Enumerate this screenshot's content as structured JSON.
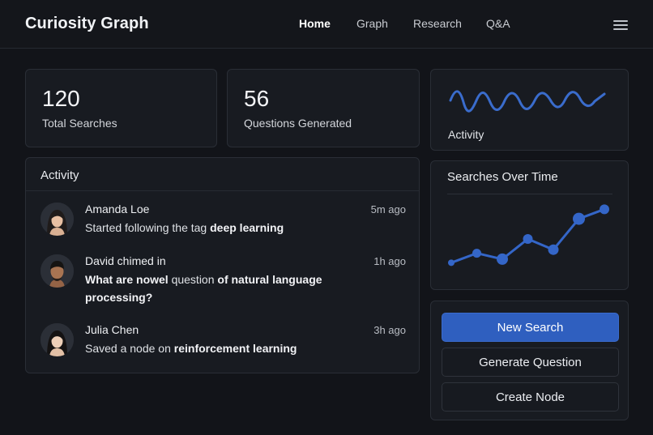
{
  "app": {
    "title": "Curiosity Graph"
  },
  "nav": {
    "items": [
      "Home",
      "Graph",
      "Research",
      "Q&A"
    ],
    "active": "Home"
  },
  "stats": [
    {
      "value": "120",
      "label": "Total Searches"
    },
    {
      "value": "56",
      "label": "Questions Generated"
    }
  ],
  "activity_mini": {
    "label": "Activity"
  },
  "activity": {
    "title": "Activity",
    "items": [
      {
        "name": "Amanda Loe",
        "time": "5m ago",
        "text_prefix": "Started following the tag ",
        "text_bold": "deep learning",
        "text_middle": "",
        "text_bold2": ""
      },
      {
        "name": "David chimed in",
        "time": "1h ago",
        "text_prefix": "",
        "text_bold": "What are nowel",
        "text_middle": " question ",
        "text_bold2": "of natural language processing?"
      },
      {
        "name": "Julia Chen",
        "time": "3h ago",
        "text_prefix": "Saved a node on ",
        "text_bold": "reinforcement learning",
        "text_middle": "",
        "text_bold2": ""
      }
    ]
  },
  "chart": {
    "title": "Searches Over Time"
  },
  "chart_data": {
    "type": "line",
    "title": "Searches Over Time",
    "x": [
      1,
      2,
      3,
      4,
      5,
      6,
      7
    ],
    "values": [
      10,
      18,
      13,
      30,
      21,
      47,
      55
    ],
    "ylim": [
      0,
      60
    ],
    "xlabel": "",
    "ylabel": "",
    "grid": false,
    "color": "#3466c8"
  },
  "actions": {
    "new_search": "New Search",
    "generate_question": "Generate Question",
    "create_node": "Create Node"
  },
  "colors": {
    "accent": "#2f5fbf",
    "background": "#121419",
    "card": "#181b21"
  }
}
